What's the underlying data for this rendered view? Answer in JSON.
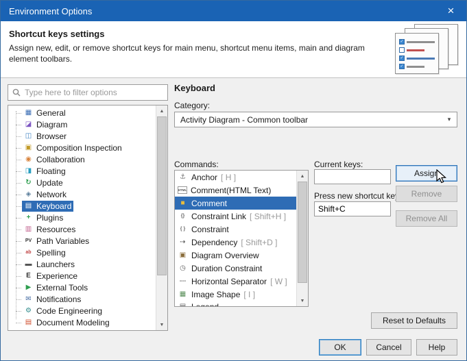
{
  "window": {
    "title": "Environment Options"
  },
  "icons": {
    "close": "×",
    "chevron_down": "▾",
    "arrow_up": "▲",
    "arrow_down": "▼",
    "check": "✓"
  },
  "colors": {
    "titlebar": "#1a63b4",
    "selection": "#2e6cb5",
    "accent": "#2f73b8"
  },
  "header": {
    "title": "Shortcut keys settings",
    "description": "Assign new, edit, or remove shortcut keys for main menu, shortcut menu items, main and diagram element toolbars."
  },
  "sidebar": {
    "filter_placeholder": "Type here to filter options",
    "items": [
      {
        "label": "General",
        "icon": "general",
        "glyph": "▦",
        "color": "#3a6db4"
      },
      {
        "label": "Diagram",
        "icon": "diagram",
        "glyph": "◪",
        "color": "#7e57c2"
      },
      {
        "label": "Browser",
        "icon": "browser",
        "glyph": "◫",
        "color": "#4285c4"
      },
      {
        "label": "Composition Inspection",
        "icon": "composition-inspection",
        "glyph": "▣",
        "color": "#c19a27"
      },
      {
        "label": "Collaboration",
        "icon": "collaboration",
        "glyph": "◉",
        "color": "#d9843d"
      },
      {
        "label": "Floating",
        "icon": "floating",
        "glyph": "◨",
        "color": "#2a9fc0"
      },
      {
        "label": "Update",
        "icon": "update",
        "glyph": "↻",
        "color": "#2e9e4f"
      },
      {
        "label": "Network",
        "icon": "network",
        "glyph": "◈",
        "color": "#5a7d9a"
      },
      {
        "label": "Keyboard",
        "icon": "keyboard",
        "glyph": "▤",
        "color": "#ffffff",
        "selected": true
      },
      {
        "label": "Plugins",
        "icon": "plugins",
        "glyph": "+",
        "color": "#2e9e4f"
      },
      {
        "label": "Resources",
        "icon": "resources",
        "glyph": "▥",
        "color": "#c2638f"
      },
      {
        "label": "Path Variables",
        "icon": "path-variables",
        "glyph": "PV",
        "color": "#333333",
        "tiny": true
      },
      {
        "label": "Spelling",
        "icon": "spelling",
        "glyph": "ab",
        "color": "#c04545",
        "tiny": true
      },
      {
        "label": "Launchers",
        "icon": "launchers",
        "glyph": "▬",
        "color": "#555555"
      },
      {
        "label": "Experience",
        "icon": "experience",
        "glyph": "E",
        "color": "#333333"
      },
      {
        "label": "External Tools",
        "icon": "external-tools",
        "glyph": "▶",
        "color": "#2e9e4f"
      },
      {
        "label": "Notifications",
        "icon": "notifications",
        "glyph": "✉",
        "color": "#4a6fa5"
      },
      {
        "label": "Code Engineering",
        "icon": "code-engineering",
        "glyph": "⚙",
        "color": "#2e8b8b"
      },
      {
        "label": "Document Modeling",
        "icon": "document-modeling",
        "glyph": "▤",
        "color": "#d05030"
      }
    ]
  },
  "main": {
    "title": "Keyboard",
    "category_label": "Category:",
    "category_value": "Activity Diagram - Common toolbar",
    "commands_label": "Commands:",
    "commands": [
      {
        "label": "Anchor",
        "key": "[ H ]",
        "icon": "anchor",
        "glyph": "⚓",
        "color": "#777777"
      },
      {
        "label": "Comment(HTML Text)",
        "key": "",
        "icon": "comment-html",
        "glyph": "HTML",
        "color": "#555555",
        "boxed": true
      },
      {
        "label": "Comment",
        "key": "",
        "icon": "comment",
        "glyph": "■",
        "color": "#e8bc3e",
        "selected": true
      },
      {
        "label": "Constraint Link",
        "key": "[ Shift+H ]",
        "icon": "constraint-link",
        "glyph": "{}",
        "color": "#666666",
        "tiny": true
      },
      {
        "label": "Constraint",
        "key": "",
        "icon": "constraint",
        "glyph": "{ }",
        "color": "#666666",
        "tiny": true
      },
      {
        "label": "Dependency",
        "key": "[ Shift+D ]",
        "icon": "dependency",
        "glyph": "⇢",
        "color": "#666666"
      },
      {
        "label": "Diagram Overview",
        "key": "",
        "icon": "diagram-overview",
        "glyph": "▣",
        "color": "#8a6d3b"
      },
      {
        "label": "Duration Constraint",
        "key": "",
        "icon": "duration-constraint",
        "glyph": "◷",
        "color": "#666666"
      },
      {
        "label": "Horizontal Separator",
        "key": "[ W ]",
        "icon": "horizontal-separator",
        "glyph": "----",
        "color": "#555555",
        "tiny": true
      },
      {
        "label": "Image Shape",
        "key": "[ I ]",
        "icon": "image-shape",
        "glyph": "▦",
        "color": "#5a8f5a"
      },
      {
        "label": "Legend",
        "key": "",
        "icon": "legend",
        "glyph": "▤",
        "color": "#666666",
        "partial": true
      }
    ],
    "current_keys_label": "Current keys:",
    "current_keys_value": "",
    "new_shortcut_label": "Press new shortcut key:",
    "new_shortcut_value": "Shift+C",
    "assign_label": "Assign",
    "remove_label": "Remove",
    "remove_all_label": "Remove All",
    "reset_label": "Reset to Defaults"
  },
  "footer": {
    "ok": "OK",
    "cancel": "Cancel",
    "help": "Help"
  }
}
